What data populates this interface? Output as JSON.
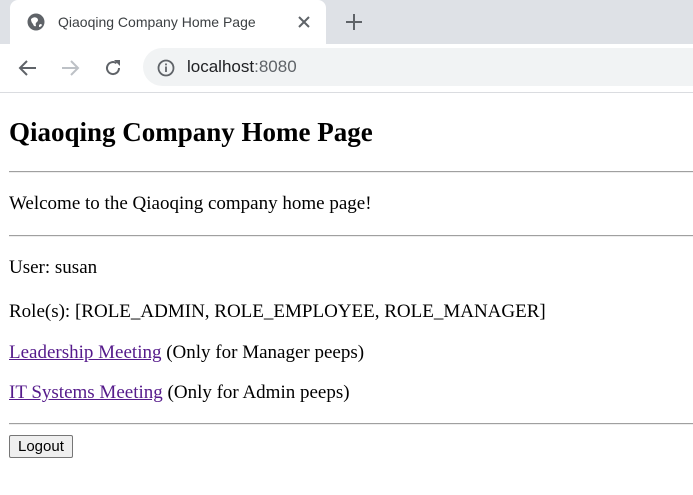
{
  "browser": {
    "tab": {
      "title": "Qiaoqing Company Home Page"
    },
    "address": {
      "host": "localhost",
      "port": ":8080"
    }
  },
  "page": {
    "heading": "Qiaoqing Company Home Page",
    "welcome": "Welcome to the Qiaoqing company home page!",
    "user_label": "User: ",
    "user_value": "susan",
    "roles_label": "Role(s): ",
    "roles_value": "[ROLE_ADMIN, ROLE_EMPLOYEE, ROLE_MANAGER]",
    "links": [
      {
        "text": "Leadership Meeting",
        "note": " (Only for Manager peeps)"
      },
      {
        "text": "IT Systems Meeting",
        "note": " (Only for Admin peeps)"
      }
    ],
    "logout_label": "Logout"
  }
}
